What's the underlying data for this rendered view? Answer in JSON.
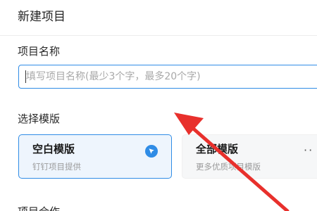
{
  "header": {
    "title": "新建项目"
  },
  "project_name": {
    "label": "项目名称",
    "value": "",
    "placeholder": "填写项目名称(最少3个字，最多20个字)"
  },
  "template": {
    "label": "选择模版",
    "cards": [
      {
        "title": "空白模版",
        "subtitle": "钉钉项目提供",
        "selected": true
      },
      {
        "title": "全部模版",
        "subtitle": "更多优质项目模版",
        "selected": false
      }
    ],
    "more_icon": "ellipsis-icon"
  },
  "next_section": {
    "label": "项目合作"
  },
  "icons": {
    "selected": "check-circle-icon",
    "annotation": "red-arrow-icon"
  },
  "colors": {
    "accent": "#2f8ce6",
    "selected_bg": "#eef5fd",
    "arrow": "#e8302c"
  }
}
